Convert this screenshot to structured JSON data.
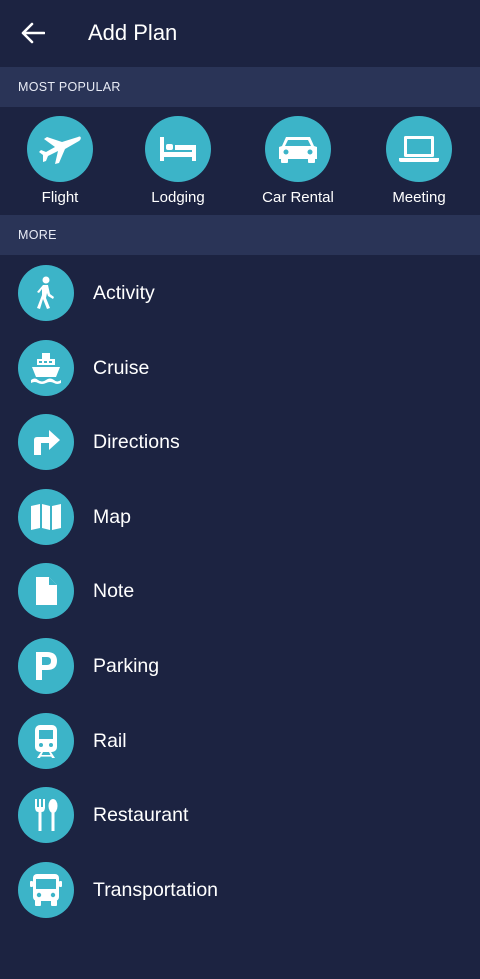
{
  "header": {
    "title": "Add Plan",
    "back_icon": "arrow-left-icon"
  },
  "sections": {
    "most_popular": "MOST POPULAR",
    "more": "MORE"
  },
  "popular": [
    {
      "label": "Flight",
      "icon": "airplane-icon"
    },
    {
      "label": "Lodging",
      "icon": "bed-icon"
    },
    {
      "label": "Car Rental",
      "icon": "car-icon"
    },
    {
      "label": "Meeting",
      "icon": "laptop-icon"
    }
  ],
  "more": [
    {
      "label": "Activity",
      "icon": "walking-person-icon"
    },
    {
      "label": "Cruise",
      "icon": "cruise-ship-icon"
    },
    {
      "label": "Directions",
      "icon": "turn-right-arrow-icon"
    },
    {
      "label": "Map",
      "icon": "folded-map-icon"
    },
    {
      "label": "Note",
      "icon": "note-document-icon"
    },
    {
      "label": "Parking",
      "icon": "parking-p-icon"
    },
    {
      "label": "Rail",
      "icon": "train-icon"
    },
    {
      "label": "Restaurant",
      "icon": "fork-spoon-icon"
    },
    {
      "label": "Transportation",
      "icon": "bus-icon"
    }
  ],
  "colors": {
    "background": "#1c2341",
    "section_header": "#2a3457",
    "icon_circle": "#3cb4c8",
    "text": "#ffffff"
  }
}
